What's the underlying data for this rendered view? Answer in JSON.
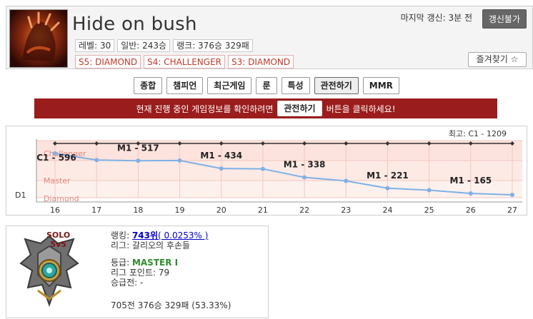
{
  "profile": {
    "name": "Hide on bush",
    "last_update_label": "마지막 갱신: 3분 전",
    "update_button": "갱신불가",
    "favorite_button": "즐겨찾기 ☆",
    "stats": [
      "레벨: 30",
      "일반: 243승",
      "랭크: 376승 329패"
    ],
    "seasons": [
      "S5: DIAMOND",
      "S4: CHALLENGER",
      "S3: DIAMOND"
    ]
  },
  "tabs": [
    {
      "label": "종합",
      "active": false
    },
    {
      "label": "챔피언",
      "active": false
    },
    {
      "label": "최근게임",
      "active": false
    },
    {
      "label": "룬",
      "active": false
    },
    {
      "label": "특성",
      "active": false
    },
    {
      "label": "관전하기",
      "active": true
    },
    {
      "label": "MMR",
      "active": false
    }
  ],
  "banner": {
    "text_before": "현재 진행 중인 게임정보를 확인하려면",
    "button": "관전하기",
    "text_after": "버튼을 클릭하세요!"
  },
  "chart_data": {
    "type": "line",
    "title": "최고: C1 - 1209",
    "x": [
      "16",
      "17",
      "18",
      "19",
      "20",
      "21",
      "22",
      "23",
      "24",
      "25",
      "26",
      "27"
    ],
    "tier_bands": [
      "Challenger",
      "Master",
      "Diamond"
    ],
    "ylabel_left": "D1",
    "series": [
      {
        "name": "",
        "color": "#7fb0e6",
        "values": [
          596,
          525,
          517,
          520,
          434,
          430,
          338,
          300,
          221,
          200,
          165,
          150
        ]
      },
      {
        "name": "",
        "color": "#333333",
        "values": [
          1209,
          1209,
          1209,
          1209,
          1209,
          1209,
          1209,
          1209,
          1209,
          1209,
          1209,
          1209
        ]
      }
    ],
    "annotations": [
      {
        "index": 0,
        "text": "C1 - 596"
      },
      {
        "index": 2,
        "text": "M1 - 517"
      },
      {
        "index": 4,
        "text": "M1 - 434"
      },
      {
        "index": 6,
        "text": "M1 - 338"
      },
      {
        "index": 8,
        "text": "M1 - 221"
      },
      {
        "index": 10,
        "text": "M1 - 165"
      }
    ]
  },
  "rank": {
    "queue_line1": "SOLO",
    "queue_line2": "5v5",
    "ranking_label": "랭킹: ",
    "ranking_value": "743위",
    "ranking_pct": "( 0.0253% )",
    "league": "리그: 갈리오의 후손들",
    "tier_label": "등급: ",
    "tier_value": "MASTER I",
    "league_points": "리그 포인트: 79",
    "promotion": "승급전: -",
    "record": "705전 376승 329패 (53.33%)"
  }
}
